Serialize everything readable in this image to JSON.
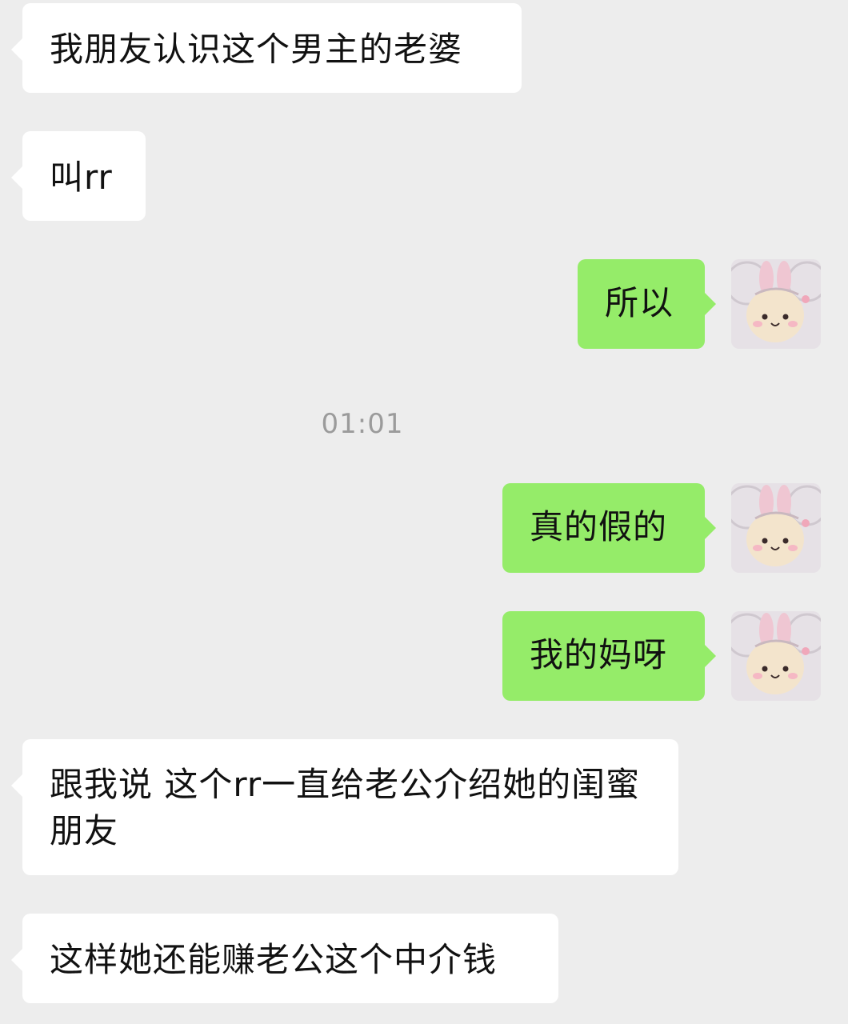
{
  "messages": [
    {
      "side": "left",
      "text": "我朋友认识这个男主的老婆"
    },
    {
      "side": "left",
      "text": "叫rr"
    },
    {
      "side": "right",
      "text": "所以"
    },
    {
      "side": "right",
      "text": "真的假的"
    },
    {
      "side": "right",
      "text": "我的妈呀"
    },
    {
      "side": "left",
      "text": "跟我说 这个rr一直给老公介绍她的闺蜜朋友"
    },
    {
      "side": "left",
      "text": "这样她还能赚老公这个中介钱"
    }
  ],
  "timestamp": "01:01",
  "avatar": {
    "icon": "plush-bunny-avatar-icon"
  },
  "colors": {
    "background": "#ededed",
    "incoming_bubble": "#ffffff",
    "outgoing_bubble": "#95ec69",
    "timestamp_text": "#9b9b9b"
  }
}
